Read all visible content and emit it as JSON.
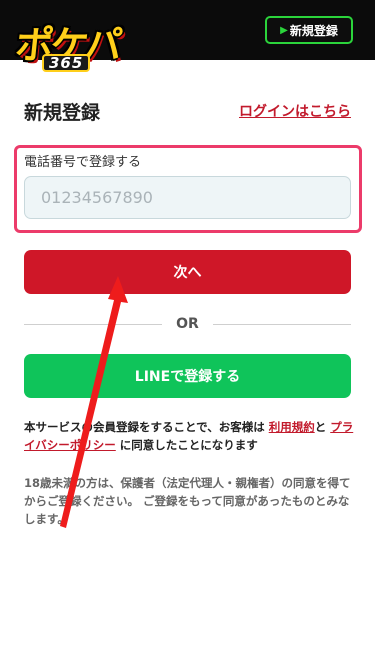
{
  "header": {
    "logo_main": "ポケパ",
    "logo_sub": "365",
    "signup_button": "新規登録"
  },
  "page": {
    "title": "新規登録",
    "login_link": "ログインはこちら"
  },
  "phone": {
    "label": "電話番号で登録する",
    "placeholder": "01234567890"
  },
  "next_button": "次へ",
  "or_text": "OR",
  "line_button": "LINEで登録する",
  "terms": {
    "prefix": "本サービスの会員登録をすることで、お客様は ",
    "terms_link": "利用規約",
    "middle": "と ",
    "privacy_link": "プライバシーポリシー",
    "suffix": " に同意したことになります"
  },
  "note": "18歳未満の方は、保護者（法定代理人・親権者）の同意を得てからご登録ください。 ご登録をもって同意があったものとみなします。",
  "colors": {
    "brand_red": "#cf1728",
    "line_green": "#0fc45a",
    "highlight_pink": "#ec3b6a",
    "annotation_arrow": "#ee1c1c"
  }
}
